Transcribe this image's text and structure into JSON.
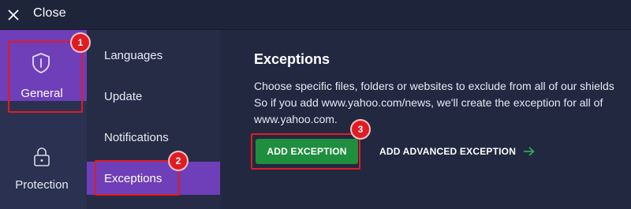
{
  "topbar": {
    "close_label": "Close"
  },
  "nav": {
    "general_label": "General",
    "protection_label": "Protection"
  },
  "subnav": {
    "items": [
      "Languages",
      "Update",
      "Notifications",
      "Exceptions"
    ],
    "active_index": 3
  },
  "content": {
    "title": "Exceptions",
    "desc_line1": "Choose specific files, folders or websites to exclude from all of our shields",
    "desc_line2": "So if you add www.yahoo.com/news, we'll create the exception for all of",
    "desc_line3": "www.yahoo.com.",
    "add_button": "ADD EXCEPTION",
    "advanced_button": "ADD ADVANCED EXCEPTION"
  },
  "annotations": {
    "badge1": "1",
    "badge2": "2",
    "badge3": "3"
  },
  "colors": {
    "accent_purple": "#6e3fb8",
    "button_green": "#1f8e3e",
    "annotation_red": "#e11b22",
    "background": "#222840"
  },
  "icons": {
    "close": "close-icon",
    "general": "shield-icon",
    "protection": "lock-icon",
    "advanced": "arrow-right-icon"
  }
}
